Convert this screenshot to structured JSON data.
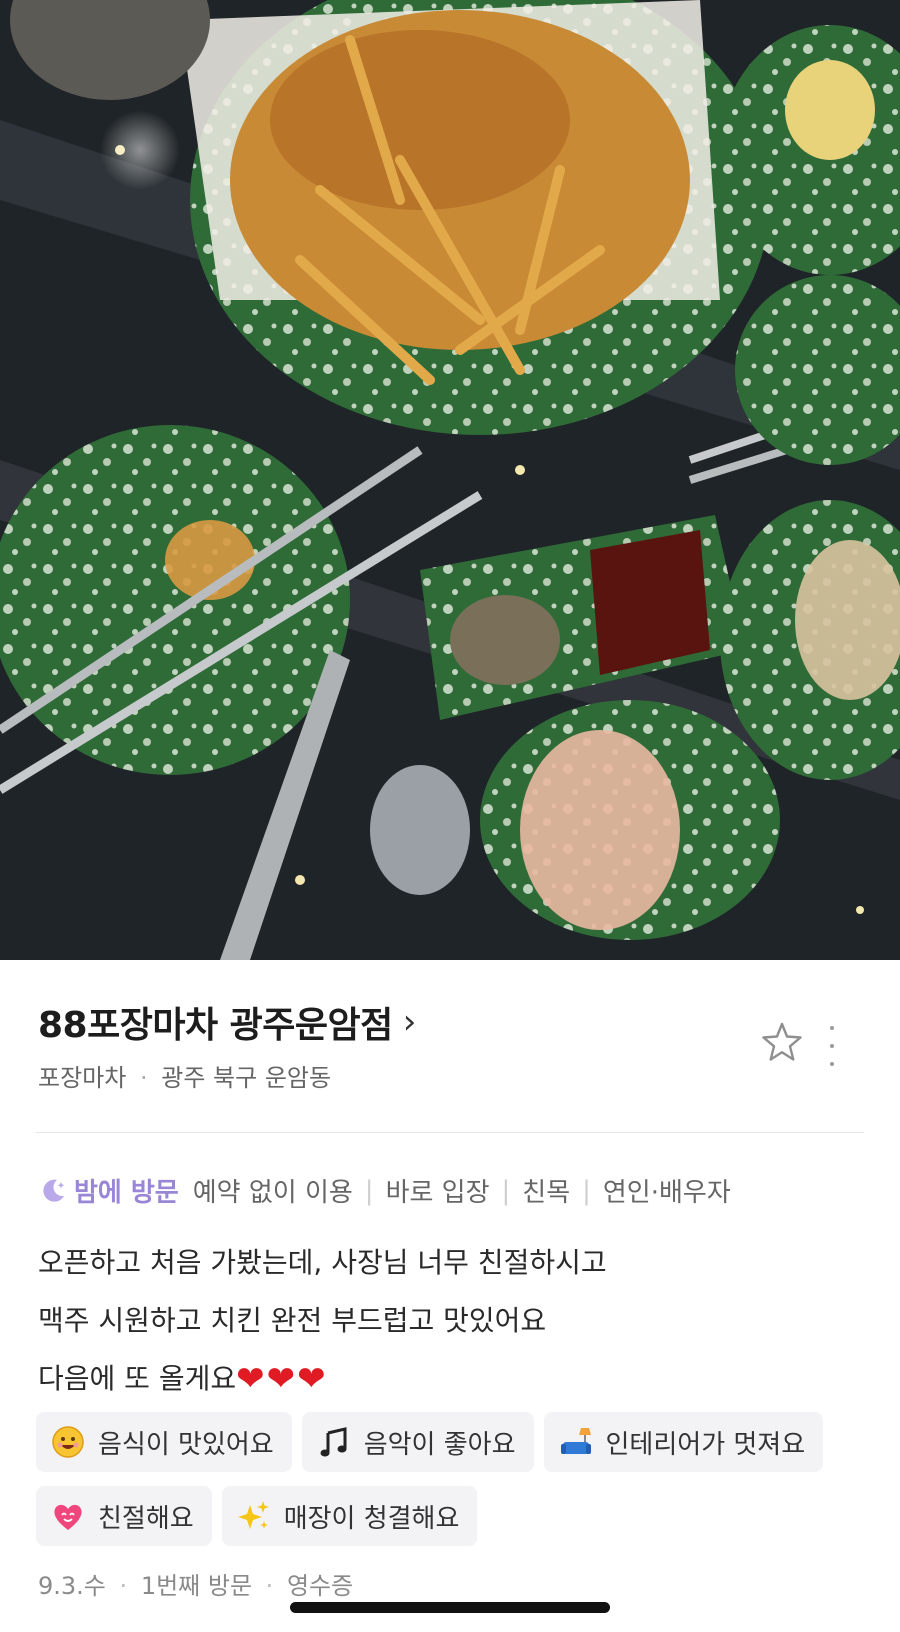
{
  "photo": {
    "alt_icon": "food-photo",
    "colors": {
      "plate": "#2f6b37",
      "speckle": "#d9e4d2",
      "table": "#22272b"
    }
  },
  "place": {
    "name": "88포장마차 광주운암점",
    "chevron": "›",
    "category": "포장마차",
    "separator": "·",
    "location": "광주 북구 운암동"
  },
  "visit": {
    "time_icon": "moon-icon",
    "time": "밤에 방문",
    "tags": [
      "예약 없이 이용",
      "바로 입장",
      "친목",
      "연인·배우자"
    ],
    "tag_separator": "|"
  },
  "review": {
    "lines": [
      "오픈하고 처음 가봤는데, 사장님 너무 친절하시고",
      "맥주 시원하고 치킨 완전 부드럽고 맛있어요",
      "다음에 또 올게요"
    ],
    "hearts": "❤❤❤"
  },
  "keywords": [
    {
      "icon": "smiley-icon",
      "label": "음식이 맛있어요"
    },
    {
      "icon": "music-note-icon",
      "label": "음악이 좋아요"
    },
    {
      "icon": "sofa-lamp-icon",
      "label": "인테리어가 멋져요"
    },
    {
      "icon": "heart-face-icon",
      "label": "친절해요"
    },
    {
      "icon": "sparkles-icon",
      "label": "매장이 청결해요"
    }
  ],
  "meta": {
    "date": "9.3.수",
    "visit_count": "1번째 방문",
    "proof": "영수증",
    "separator": "·"
  },
  "accent": "#9a86d6"
}
